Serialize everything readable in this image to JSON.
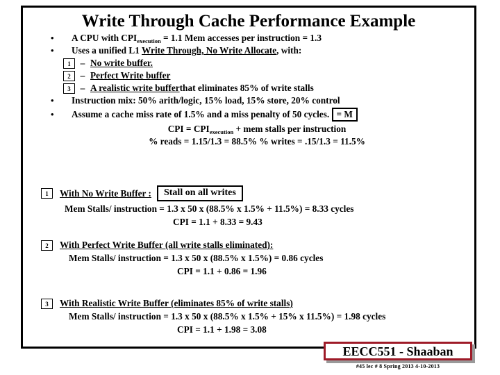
{
  "slide": {
    "title": "Write Through Cache Performance Example",
    "bullets": [
      {
        "marker": "•",
        "pre": "A CPU with  CPI",
        "sub": "execution",
        "post": " =  1.1  Mem  accesses per instruction =  1.3"
      },
      {
        "marker": "•",
        "pre": "Uses a unified L1 ",
        "underline": "Write Through, No Write Allocate",
        "post": ",  with:"
      }
    ],
    "sub_bullets": [
      {
        "num": "1",
        "dash": "–",
        "text": "No write buffer.",
        "underline_all": true,
        "tail": ""
      },
      {
        "num": "2",
        "dash": "–",
        "text": "Perfect Write buffer",
        "underline_all": true,
        "tail": ""
      },
      {
        "num": "3",
        "dash": "–",
        "text": "A realistic write buffer ",
        "underline_all": true,
        "tail": "that eliminates 85% of write stalls"
      }
    ],
    "bullets2": [
      {
        "marker": "•",
        "text": "Instruction mix:   50% arith/logic,  15% load, 15% store, 20% control"
      },
      {
        "marker": "•",
        "text": "Assume a cache miss rate of 1.5% and a miss penalty of 50 cycles.",
        "box_label": "= M"
      }
    ],
    "formula_lines": [
      {
        "pre": "CPI =   CPI",
        "sub": "execution",
        "post": "   +    mem stalls per instruction"
      }
    ],
    "percent_line": "% reads =  1.15/1.3 =   88.5%          % writes =  .15/1.3 =  11.5%",
    "cases": [
      {
        "num": "1",
        "heading": "With No Write Buffer :",
        "badge": "Stall on all writes",
        "line1": "Mem Stalls/ instruction  =   1.3 x 50  x  (88.5%  x  1.5%  +  11.5%) = 8.33 cycles",
        "line2": "CPI =  1.1  + 8.33 =   9.43"
      },
      {
        "num": "2",
        "heading": "With Perfect Write Buffer (all write stalls eliminated):",
        "badge": "",
        "line1": "Mem Stalls/ instruction  =   1.3 x 50  x  (88.5%  x  1.5%) = 0.86 cycles",
        "line2": "CPI =  1.1  + 0.86 =   1.96"
      },
      {
        "num": "3",
        "heading": "With Realistic Write Buffer (eliminates 85% of write stalls)",
        "badge": "",
        "line1": "Mem Stalls/ instruction  =   1.3 x 50  x  (88.5%  x  1.5%  +  15% x 11.5%) = 1.98 cycles",
        "line2": "CPI =  1.1  + 1.98 =   3.08"
      }
    ]
  },
  "footer": {
    "stamp": "EECC551 - Shaaban",
    "caption": "#45  lec # 8   Spring 2013  4-10-2013",
    "accent_color": "#9e1b28",
    "shadow_color": "#9a9a9a"
  }
}
